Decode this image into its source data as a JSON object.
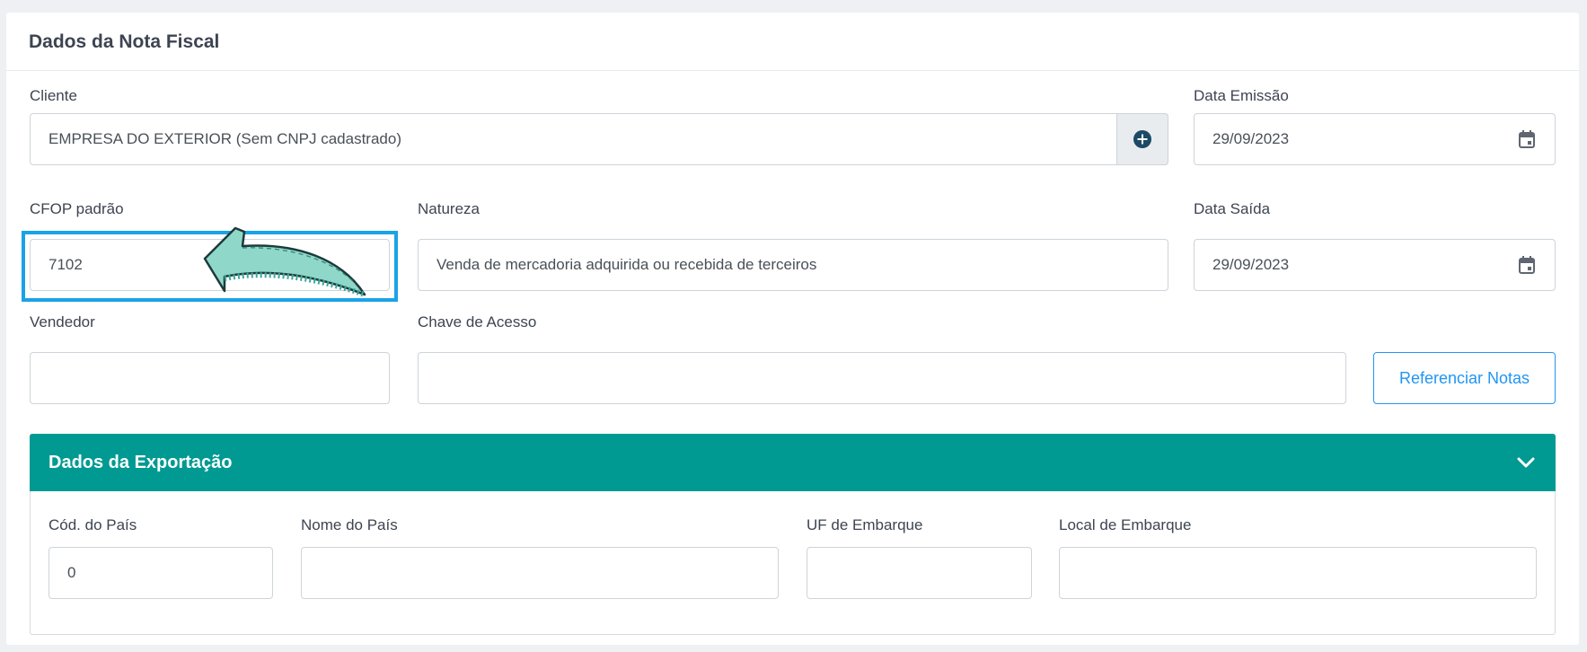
{
  "section": {
    "title": "Dados da Nota Fiscal"
  },
  "cliente": {
    "label": "Cliente",
    "value": "EMPRESA DO EXTERIOR (Sem CNPJ cadastrado)",
    "add_icon": "plus-circle-icon"
  },
  "data_emissao": {
    "label": "Data Emissão",
    "value": "29/09/2023",
    "icon": "calendar-icon"
  },
  "cfop": {
    "label": "CFOP padrão",
    "value": "7102"
  },
  "natureza": {
    "label": "Natureza",
    "value": "Venda de mercadoria adquirida ou recebida de terceiros"
  },
  "data_saida": {
    "label": "Data Saída",
    "value": "29/09/2023",
    "icon": "calendar-icon"
  },
  "vendedor": {
    "label": "Vendedor",
    "value": ""
  },
  "chave_acesso": {
    "label": "Chave de Acesso",
    "value": ""
  },
  "referenciar_button": {
    "label": "Referenciar Notas"
  },
  "exportacao": {
    "title": "Dados da Exportação",
    "toggle_icon": "chevron-down-icon",
    "cod_pais": {
      "label": "Cód. do País",
      "value": "0"
    },
    "nome_pais": {
      "label": "Nome do País",
      "value": ""
    },
    "uf_embarque": {
      "label": "UF de Embarque",
      "value": ""
    },
    "local_embarque": {
      "label": "Local de Embarque",
      "value": ""
    }
  },
  "colors": {
    "accent": "#009a93",
    "highlight": "#1aa3e6",
    "button": "#2196f3",
    "arrow": "#8fd8c9"
  },
  "annotation": {
    "icon": "arrow-left-annotation-icon"
  }
}
